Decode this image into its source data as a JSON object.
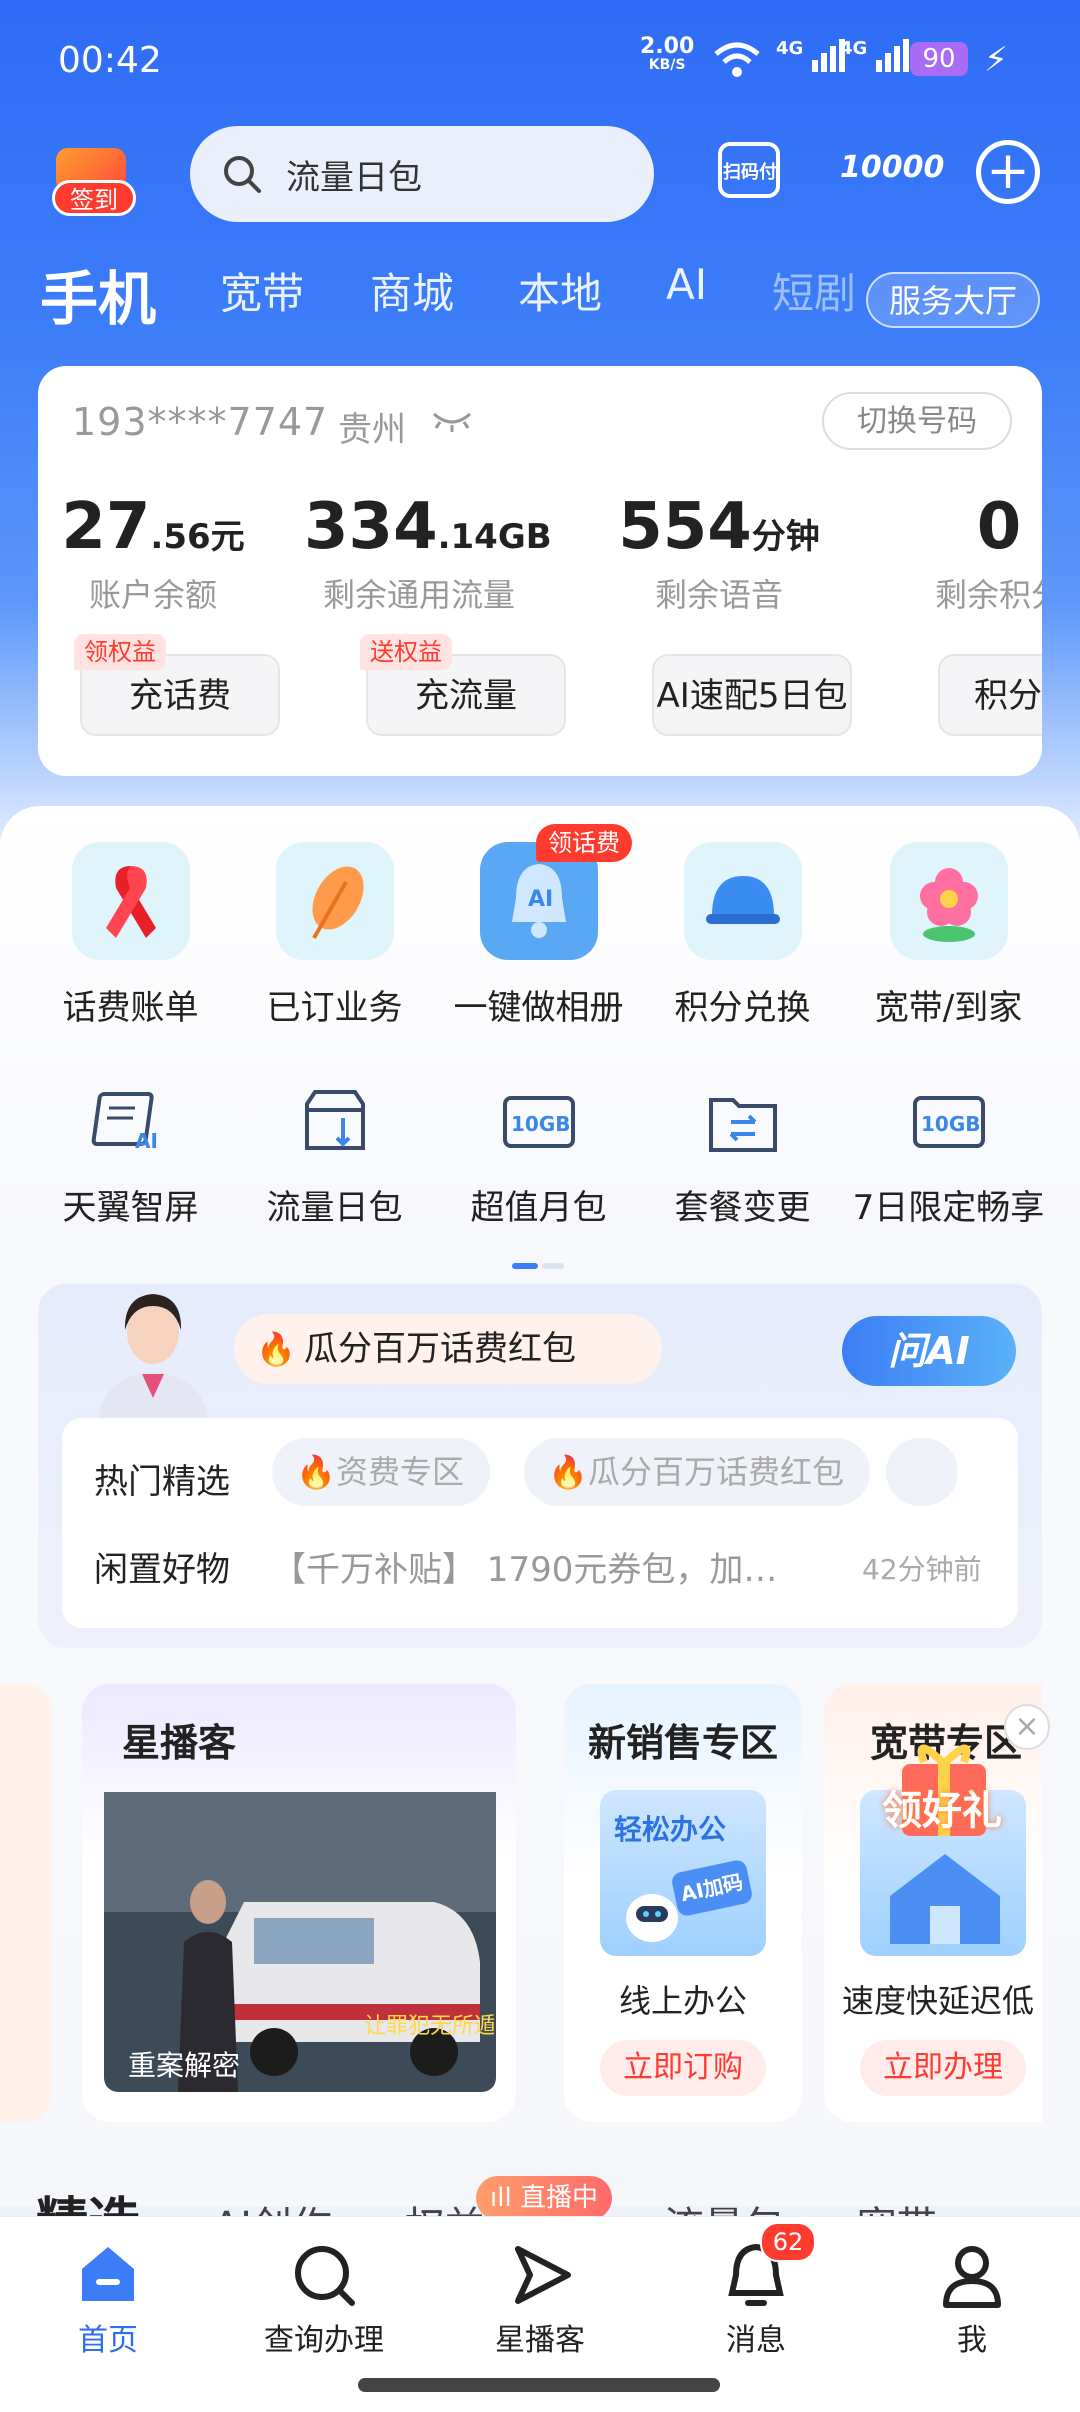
{
  "status": {
    "time": "00:42",
    "net_speed": "2.00",
    "net_unit": "KB/S",
    "sig1": "4G",
    "sig2": "4G",
    "battery": "90"
  },
  "top": {
    "signin": "签到",
    "search_placeholder": "流量日包",
    "scan_label": "扫码付",
    "hotline": "10000"
  },
  "tabs": [
    {
      "label": "手机"
    },
    {
      "label": "宽带"
    },
    {
      "label": "商城"
    },
    {
      "label": "本地"
    },
    {
      "label": "AI"
    },
    {
      "label": "短剧"
    }
  ],
  "service_hall": "服务大厅",
  "account": {
    "phone": "193****7747",
    "region": "贵州",
    "switch": "切换号码",
    "stats": [
      {
        "value": "27",
        "decimal": ".56",
        "unit": "元",
        "label": "账户余额"
      },
      {
        "value": "334",
        "decimal": ".14",
        "unit": "GB",
        "label": "剩余通用流量"
      },
      {
        "value": "554",
        "decimal": "",
        "unit": "分钟",
        "label": "剩余语音"
      },
      {
        "value": "0",
        "decimal": "",
        "unit": "",
        "label": "剩余积分"
      }
    ],
    "buttons": [
      {
        "label": "充话费",
        "tag": "领权益"
      },
      {
        "label": "充流量",
        "tag": "送权益"
      },
      {
        "label": "AI速配5日包",
        "tag": ""
      },
      {
        "label": "积分",
        "tag": ""
      }
    ]
  },
  "grid_row1": [
    {
      "label": "话费账单",
      "icon": "ribbon-icon"
    },
    {
      "label": "已订业务",
      "icon": "leaf-icon"
    },
    {
      "label": "一键做相册",
      "icon": "ai-bell-icon",
      "badge": "领话费"
    },
    {
      "label": "积分兑换",
      "icon": "helmet-icon"
    },
    {
      "label": "宽带/到家",
      "icon": "flower-icon"
    }
  ],
  "grid_row2": [
    {
      "label": "天翼智屏",
      "icon": "ai-screen-icon"
    },
    {
      "label": "流量日包",
      "icon": "data-daily-icon"
    },
    {
      "label": "超值月包",
      "icon": "10gb-icon",
      "text": "10GB"
    },
    {
      "label": "套餐变更",
      "icon": "swap-icon"
    },
    {
      "label": "7日限定畅享",
      "icon": "10gb-icon",
      "text": "10GB"
    }
  ],
  "ai": {
    "bubble": "瓜分百万话费红包",
    "ask": "问AI",
    "hot_label": "热门精选",
    "chips": [
      "资费专区",
      "瓜分百万话费红包"
    ],
    "idle_label": "闲置好物",
    "idle_text": "【千万补贴】 1790元券包，加…",
    "idle_time": "42分钟前"
  },
  "cards": [
    {
      "title": "星播客",
      "caption": "重案解密",
      "overlay": "让罪犯无所遁"
    },
    {
      "title": "新销售专区",
      "img_text": "轻松办公",
      "img_badge": "AI加码",
      "sub": "线上办公",
      "btn": "立即订购"
    },
    {
      "title": "宽带专区",
      "img_badge": "领好礼",
      "sub": "速度快延迟低",
      "btn": "立即办理"
    }
  ],
  "section_tabs": [
    "精选",
    "AI创作",
    "权益",
    "商城",
    "流量包",
    "宽带"
  ],
  "live_badge": "直播中",
  "nav": [
    {
      "label": "首页"
    },
    {
      "label": "查询办理"
    },
    {
      "label": "星播客"
    },
    {
      "label": "消息",
      "badge": "62"
    },
    {
      "label": "我"
    }
  ],
  "colors": {
    "primary": "#2f6cf6",
    "accent_red": "#ff3b30"
  }
}
